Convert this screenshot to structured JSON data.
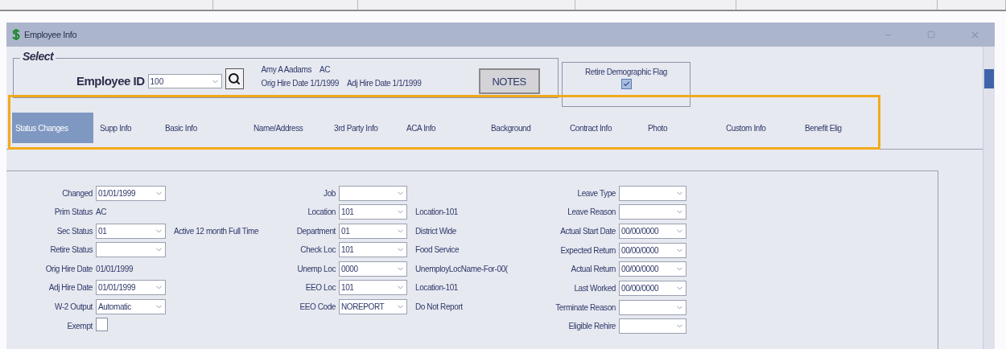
{
  "window": {
    "title": "Employee Info"
  },
  "select": {
    "legend": "Select",
    "employee_id_label": "Employee ID",
    "employee_id": "100",
    "employee_name": "Amy A Aadams",
    "status": "AC",
    "orig_hire": "Orig Hire Date 1/1/1999",
    "adj_hire": "Adj Hire Date 1/1/1999",
    "notes_button": "NOTES"
  },
  "retire_flag": {
    "label": "Retire Demographic Flag",
    "checked": true
  },
  "tabs": [
    {
      "label": "Status Changes",
      "selected": true
    },
    {
      "label": "Supp Info",
      "selected": false
    },
    {
      "label": "Basic Info",
      "selected": false
    },
    {
      "label": "Name/Address",
      "selected": false
    },
    {
      "label": "3rd Party Info",
      "selected": false
    },
    {
      "label": "ACA Info",
      "selected": false
    },
    {
      "label": "Background",
      "selected": false
    },
    {
      "label": "Contract Info",
      "selected": false
    },
    {
      "label": "Photo",
      "selected": false
    },
    {
      "label": "Custom Info",
      "selected": false
    },
    {
      "label": "Benefit Elig",
      "selected": false
    }
  ],
  "form": {
    "columns": [
      {
        "rows": [
          {
            "kind": "dropdown",
            "label": "Changed",
            "value": "01/01/1999"
          },
          {
            "kind": "text",
            "label": "Prim Status",
            "value": "AC"
          },
          {
            "kind": "dropdown",
            "label": "Sec Status",
            "value": "01",
            "description": "Active 12 month Full Time"
          },
          {
            "kind": "dropdown",
            "label": "Retire Status"
          },
          {
            "kind": "text",
            "label": "Orig Hire Date",
            "value": "01/01/1999"
          },
          {
            "kind": "dropdown",
            "label": "Adj Hire Date",
            "value": "01/01/1999"
          },
          {
            "kind": "dropdown",
            "label": "W-2 Output",
            "value": "Automatic"
          },
          {
            "kind": "checkbox",
            "label": "Exempt",
            "checked": false
          }
        ]
      },
      {
        "rows": [
          {
            "kind": "dropdown",
            "label": "Job"
          },
          {
            "kind": "dropdown",
            "label": "Location",
            "value": "101",
            "description": "Location-101"
          },
          {
            "kind": "dropdown",
            "label": "Department",
            "value": "01",
            "description": "District Wide"
          },
          {
            "kind": "dropdown",
            "label": "Check Loc",
            "value": "101",
            "description": "Food Service"
          },
          {
            "kind": "dropdown",
            "label": "Unemp Loc",
            "value": "0000",
            "description": "UnemployLocName-For-00("
          },
          {
            "kind": "dropdown",
            "label": "EEO Loc",
            "value": "101",
            "description": "Location-101"
          },
          {
            "kind": "dropdown",
            "label": "EEO Code",
            "value": "NOREPORT",
            "description": "Do Not Report"
          }
        ]
      },
      {
        "rows": [
          {
            "kind": "dropdown",
            "label": "Leave Type"
          },
          {
            "kind": "dropdown",
            "label": "Leave Reason"
          },
          {
            "kind": "dropdown",
            "label": "Actual Start Date",
            "value": "00/00/0000"
          },
          {
            "kind": "dropdown",
            "label": "Expected Return",
            "value": "00/00/0000"
          },
          {
            "kind": "dropdown",
            "label": "Actual Return",
            "value": "00/00/0000"
          },
          {
            "kind": "dropdown",
            "label": "Last Worked",
            "value": "00/00/0000"
          },
          {
            "kind": "dropdown",
            "label": "Terminate Reason"
          },
          {
            "kind": "dropdown",
            "label": "Eligible Rehire"
          }
        ]
      }
    ]
  }
}
